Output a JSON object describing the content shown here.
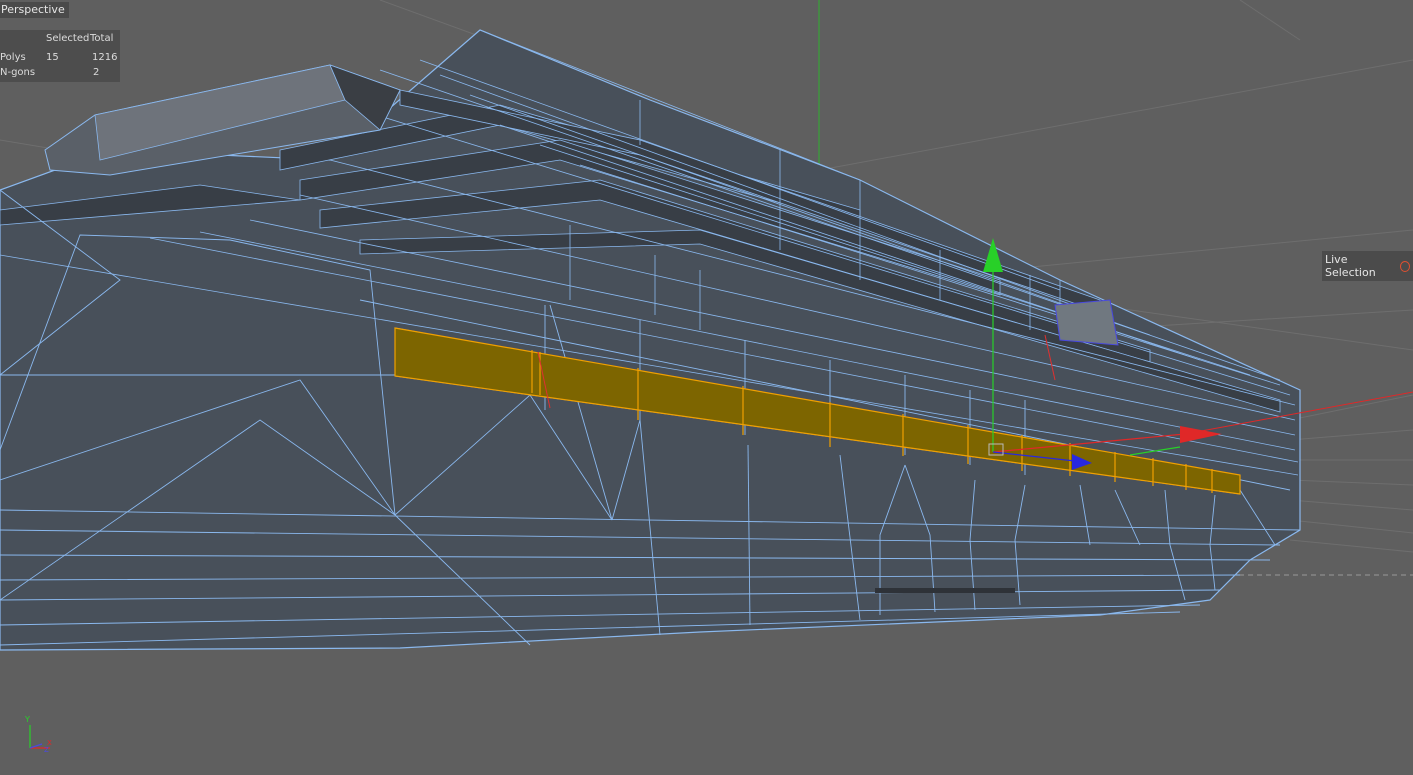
{
  "viewport": {
    "view_name": "Perspective",
    "active_tool": "Live Selection",
    "tool_icon": "selection-ring-icon"
  },
  "hud": {
    "headers": {
      "selected": "Selected",
      "total": "Total"
    },
    "rows": [
      {
        "label": "Polys",
        "selected": "15",
        "total": "1216"
      },
      {
        "label": "N-gons",
        "selected": "",
        "total": "2"
      }
    ]
  },
  "axis_indicator": {
    "y": "Y",
    "x": "X",
    "z": "Z"
  },
  "colors": {
    "background": "#5f5f5f",
    "mesh_face": "#48505a",
    "wire": "#8ab8ee",
    "selection_fill": "#7d6500",
    "selection_edge": "#f0a000",
    "axis_x": "#e02828",
    "axis_y": "#28d028",
    "axis_z": "#2828e0"
  }
}
